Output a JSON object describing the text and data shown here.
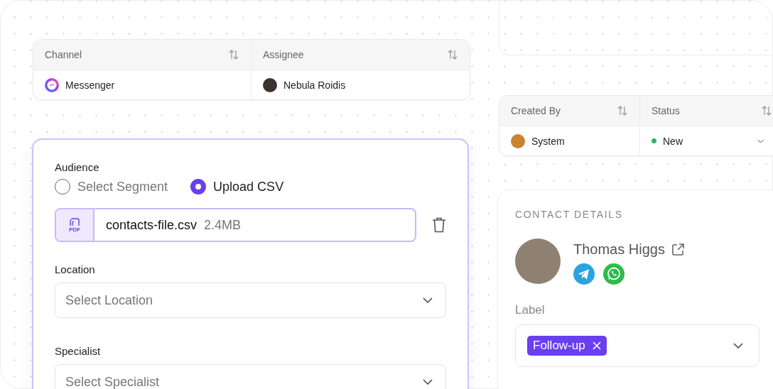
{
  "table_1": {
    "columns": [
      {
        "label": "Channel"
      },
      {
        "label": "Assignee"
      }
    ],
    "row": {
      "channel": "Messenger",
      "assignee": "Nebula Roidis"
    }
  },
  "table_2": {
    "columns": [
      {
        "label": "Created By"
      },
      {
        "label": "Status"
      }
    ],
    "row": {
      "created_by": "System",
      "status": "New"
    }
  },
  "audience": {
    "label": "Audience",
    "options": [
      {
        "label": "Select Segment",
        "selected": false
      },
      {
        "label": "Upload CSV",
        "selected": true
      }
    ],
    "file": {
      "badge": "PDF",
      "name": "contacts-file.csv",
      "size": "2.4MB"
    }
  },
  "location": {
    "label": "Location",
    "placeholder": "Select Location"
  },
  "specialist": {
    "label": "Specialist",
    "placeholder": "Select Specialist"
  },
  "contact": {
    "heading": "CONTACT DETAILS",
    "name": "Thomas Higgs",
    "label_title": "Label",
    "tags": [
      {
        "label": "Follow-up"
      }
    ]
  }
}
